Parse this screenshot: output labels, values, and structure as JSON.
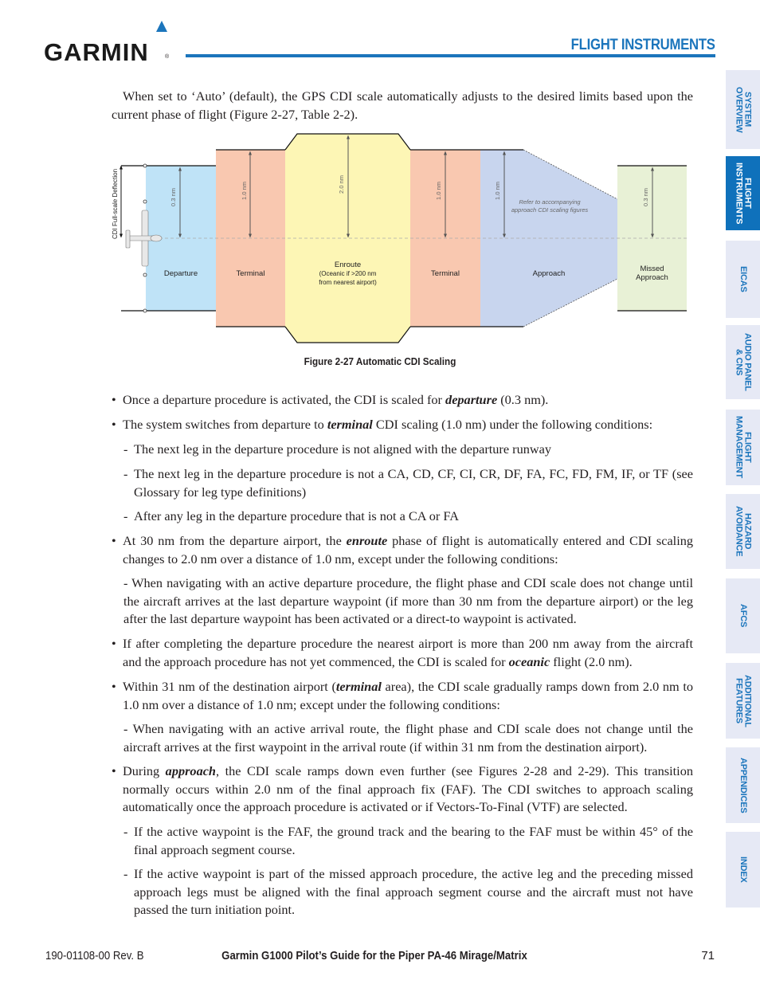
{
  "header": {
    "logo_text": "GARMIN",
    "logo_reg": "®",
    "section_title": "FLIGHT INSTRUMENTS"
  },
  "side_tabs": [
    {
      "label": "SYSTEM\nOVERVIEW",
      "active": false
    },
    {
      "label": "FLIGHT\nINSTRUMENTS",
      "active": true
    },
    {
      "label": "EICAS",
      "active": false
    },
    {
      "label": "AUDIO PANEL\n& CNS",
      "active": false
    },
    {
      "label": "FLIGHT\nMANAGEMENT",
      "active": false
    },
    {
      "label": "HAZARD\nAVOIDANCE",
      "active": false
    },
    {
      "label": "AFCS",
      "active": false
    },
    {
      "label": "ADDITIONAL\nFEATURES",
      "active": false
    },
    {
      "label": "APPENDICES",
      "active": false
    },
    {
      "label": "INDEX",
      "active": false
    }
  ],
  "intro": "When set to ‘Auto’ (default), the GPS CDI scale automatically adjusts to the desired limits based upon the current phase of flight (Figure 2-27, Table 2-2).",
  "figure": {
    "caption": "Figure 2-27  Automatic CDI Scaling",
    "axis_label": "CDI Full-scale Deflection",
    "segments": [
      {
        "name": "Departure",
        "scale": "0.3 nm",
        "color": "#bfe3f7"
      },
      {
        "name": "Terminal",
        "scale": "1.0 nm",
        "color": "#f9c8b0"
      },
      {
        "name": "Enroute",
        "sub": "(Oceanic if >200 nm",
        "sub2": "from nearest airport)",
        "scale": "2.0 nm",
        "color": "#fdf6b5"
      },
      {
        "name": "Terminal",
        "scale": "1.0 nm",
        "color": "#f9c8b0"
      },
      {
        "name": "Approach",
        "scale": "1.0 nm",
        "color": "#c8d5ee"
      },
      {
        "name": "Missed",
        "name2": "Approach",
        "scale": "0.3 nm",
        "color": "#e8f1d6"
      }
    ],
    "note_line1": "Refer to accompanying",
    "note_line2": "approach CDI scaling figures"
  },
  "content": {
    "b1": {
      "pre": "Once a departure procedure is activated, the CDI is scaled for ",
      "kw": "departure",
      "post": " (0.3 nm)."
    },
    "b2": {
      "pre": "The system switches from departure to ",
      "kw": "terminal",
      "post": " CDI scaling (1.0 nm) under the following conditions:"
    },
    "b2_s1": "The next leg in the departure procedure is not aligned with the departure runway",
    "b2_s2": "The next leg in the departure procedure is not a CA, CD, CF, CI, CR, DF, FA, FC, FD, FM, IF, or TF (see Glossary for leg type definitions)",
    "b2_s3": "After any leg in the departure procedure that is not a CA or FA",
    "b3": {
      "pre": "At 30 nm from the departure airport, the ",
      "kw": "enroute",
      "post": " phase of flight is automatically entered and CDI scaling changes to 2.0 nm over a distance of 1.0 nm, except under the following conditions:"
    },
    "b3_s1": "- When navigating with an active departure procedure, the flight phase and CDI scale does not change until the aircraft arrives at the last departure waypoint (if more than 30 nm from the departure airport) or the leg after the last departure waypoint has been activated or a direct-to waypoint is activated.",
    "b4": {
      "pre": "If after completing the departure procedure the nearest airport is more than 200 nm away from the aircraft and the approach procedure has not yet commenced, the CDI is scaled for ",
      "kw": "oceanic",
      "post": " flight (2.0 nm)."
    },
    "b5": {
      "pre": "Within 31 nm of the destination airport (",
      "kw": "terminal",
      "post": " area), the CDI scale gradually ramps down from 2.0 nm to 1.0 nm over a distance of 1.0 nm; except under the following conditions:"
    },
    "b5_s1": "- When navigating with an active arrival route, the flight phase and CDI scale does not change until the aircraft arrives at the first waypoint in the arrival route (if within 31 nm from the destination airport).",
    "b6": {
      "pre": "During ",
      "kw": "approach",
      "post": ", the CDI scale ramps down even further (see Figures 2-28 and 2-29).  This transition normally occurs within 2.0 nm of the final approach fix (FAF).  The CDI switches to approach scaling automatically once the approach procedure is activated or if Vectors-To-Final (VTF) are selected."
    },
    "b6_s1": "If the active waypoint is the FAF, the ground track and the bearing to the FAF must be within 45° of the final approach segment course.",
    "b6_s2": "If the active waypoint is part of the missed approach procedure, the active leg and the preceding missed approach legs must be aligned with the final approach segment course and the aircraft must not have passed the turn initiation point.",
    "bullet": "•",
    "dash": "-"
  },
  "footer": {
    "doc_number": "190-01108-00  Rev. B",
    "title": "Garmin G1000 Pilot’s Guide for the Piper PA-46 Mirage/Matrix",
    "page": "71"
  }
}
